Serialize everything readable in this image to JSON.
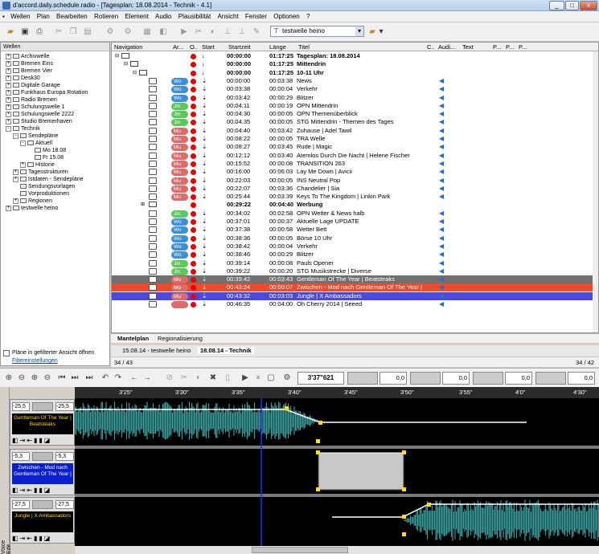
{
  "window": {
    "title": "d'accord.daily.schedule.radio - [Tagesplan: 18.08.2014 - Technik - 4.1]",
    "min": "_",
    "max": "□",
    "close": "x"
  },
  "menu": [
    "Wellen",
    "Plan",
    "Bearbeiten",
    "Rotieren",
    "Element",
    "Audio",
    "Plausibilität",
    "Ansicht",
    "Fenster",
    "Optionen",
    "?"
  ],
  "toolbar": {
    "wellen_combo": "testwelle heino"
  },
  "left": {
    "header": "Wellen",
    "tree": [
      {
        "label": "Archivwelle",
        "level": 0,
        "exp": "+"
      },
      {
        "label": "Bremen Eins",
        "level": 0,
        "exp": "+"
      },
      {
        "label": "Bremen Vier",
        "level": 0,
        "exp": "+"
      },
      {
        "label": "Desk30",
        "level": 0,
        "exp": "+"
      },
      {
        "label": "Digitale Garage",
        "level": 0,
        "exp": "+"
      },
      {
        "label": "Funkhaus Europa Rotation",
        "level": 0,
        "exp": "+"
      },
      {
        "label": "Radio Bremen",
        "level": 0,
        "exp": "+"
      },
      {
        "label": "Schulungswelle 1",
        "level": 0,
        "exp": "+"
      },
      {
        "label": "Schulungswelle 2222",
        "level": 0,
        "exp": "+"
      },
      {
        "label": "Studio Bremerhaven",
        "level": 0,
        "exp": "+"
      },
      {
        "label": "Technik",
        "level": 0,
        "exp": "-"
      },
      {
        "label": "Sendepläne",
        "level": 1,
        "exp": "-"
      },
      {
        "label": "Aktuell",
        "level": 2,
        "exp": "-"
      },
      {
        "label": "Mo 18.08",
        "level": 3,
        "exp": ""
      },
      {
        "label": "Fr 15.08",
        "level": 3,
        "exp": ""
      },
      {
        "label": "Historie",
        "level": 2,
        "exp": "+"
      },
      {
        "label": "Tagesstrukturen",
        "level": 1,
        "exp": "+"
      },
      {
        "label": "Istdaten - Sendepläne",
        "level": 1,
        "exp": "+"
      },
      {
        "label": "Sendungsvorlagen",
        "level": 1,
        "exp": ""
      },
      {
        "label": "Vorproduktionen",
        "level": 1,
        "exp": ""
      },
      {
        "label": "Regionen",
        "level": 1,
        "exp": "+"
      },
      {
        "label": "testwelle heino",
        "level": 0,
        "exp": "+"
      }
    ],
    "checkbox_label": "Pläne in gefilterter Ansicht öffnen",
    "filter_link": "Filtereinstellungen"
  },
  "grid": {
    "headers": [
      "Navigation",
      "Ar...",
      "O..",
      "Start",
      "Startzeit",
      "Länge",
      "Titel",
      "C..",
      "Audi...",
      "Text",
      "P...",
      "P...",
      "P..."
    ],
    "rows": [
      {
        "type": "group",
        "startzeit": "00:00:00",
        "laenge": "01:17:25",
        "titel": "Tagesplan: 18.08.2014",
        "indent": 0
      },
      {
        "type": "group",
        "startzeit": "00:00:00",
        "laenge": "01:17:25",
        "titel": "Mittendrin",
        "indent": 1
      },
      {
        "type": "group",
        "startzeit": "00:00:00",
        "laenge": "01:17:25",
        "titel": "10-11 Uhr",
        "indent": 2
      },
      {
        "pill": "Wo",
        "pc": "#3a8ee0",
        "startzeit": "00:00:00",
        "laenge": "00:03:38",
        "titel": "News"
      },
      {
        "pill": "Wo",
        "pc": "#3a8ee0",
        "startzeit": "00:03:38",
        "laenge": "00:00:04",
        "titel": "Verkehr"
      },
      {
        "pill": "Wo",
        "pc": "#3a8ee0",
        "startzeit": "00:03:42",
        "laenge": "00:00:29",
        "titel": "Blitzer"
      },
      {
        "pill": "Jin",
        "pc": "#5cc85c",
        "startzeit": "00:04:11",
        "laenge": "00:00:19",
        "titel": "OPN Mittendrin"
      },
      {
        "pill": "Jin",
        "pc": "#5cc85c",
        "startzeit": "00:04:30",
        "laenge": "00:00:05",
        "titel": "OPN Themenüberblick"
      },
      {
        "pill": "Jin",
        "pc": "#5cc85c",
        "startzeit": "00:04:35",
        "laenge": "00:00:05",
        "titel": "STG Mittendrin - Themen des Tages"
      },
      {
        "pill": "Mu",
        "pc": "#e06a6a",
        "startzeit": "00:04:40",
        "laenge": "00:03:42",
        "titel": "Zuhause | Adel Tawil"
      },
      {
        "pill": "Mu",
        "pc": "#e06a6a",
        "startzeit": "00:08:22",
        "laenge": "00:00:05",
        "titel": "TRA Welle"
      },
      {
        "pill": "Mu",
        "pc": "#e06a6a",
        "startzeit": "00:08:27",
        "laenge": "00:03:45",
        "titel": "Rude | Magic"
      },
      {
        "pill": "Mu",
        "pc": "#e06a6a",
        "startzeit": "00:12:12",
        "laenge": "00:03:40",
        "titel": "Atemlos Durch Die Nacht | Helene Fischer"
      },
      {
        "pill": "Mu",
        "pc": "#e06a6a",
        "startzeit": "00:15:52",
        "laenge": "00:00:08",
        "titel": "TRANSITION 263"
      },
      {
        "pill": "Mu",
        "pc": "#e06a6a",
        "startzeit": "00:16:00",
        "laenge": "00:06:03",
        "titel": "Lay Me Down | Avicii"
      },
      {
        "pill": "Mu",
        "pc": "#e06a6a",
        "startzeit": "00:22:03",
        "laenge": "00:00:05",
        "titel": "INS Neutral Pop"
      },
      {
        "pill": "Mu",
        "pc": "#e06a6a",
        "startzeit": "00:22:07",
        "laenge": "00:03:36",
        "titel": "Chandelier | Sia"
      },
      {
        "pill": "Mu",
        "pc": "#e06a6a",
        "startzeit": "00:25:44",
        "laenge": "00:03:39",
        "titel": "Keys To The Kingdom | Linkin Park"
      },
      {
        "type": "group2",
        "startzeit": "00:29:22",
        "laenge": "00:04:40",
        "titel": "Werbung"
      },
      {
        "pill": "Jin",
        "pc": "#5cc85c",
        "startzeit": "00:34:02",
        "laenge": "00:02:58",
        "titel": "OPN Wetter & News halb"
      },
      {
        "pill": "Wo",
        "pc": "#3a8ee0",
        "startzeit": "00:37:01",
        "laenge": "00:00:37",
        "titel": "Aktuelle Lage UPDATE"
      },
      {
        "pill": "Wo",
        "pc": "#3a8ee0",
        "startzeit": "00:37:38",
        "laenge": "00:00:58",
        "titel": "Wetter Bett"
      },
      {
        "pill": "Wo",
        "pc": "#3a8ee0",
        "startzeit": "00:38:36",
        "laenge": "00:00:05",
        "titel": "Börse 10 Uhr"
      },
      {
        "pill": "Wo",
        "pc": "#3a8ee0",
        "startzeit": "00:38:42",
        "laenge": "00:00:04",
        "titel": "Verkehr"
      },
      {
        "pill": "Wo",
        "pc": "#3a8ee0",
        "startzeit": "00:38:46",
        "laenge": "00:00:29",
        "titel": "Blitzer"
      },
      {
        "pill": "Jin",
        "pc": "#5cc85c",
        "startzeit": "00:39:14",
        "laenge": "00:00:08",
        "titel": "Pauls Opener"
      },
      {
        "pill": "Jin",
        "pc": "#5cc85c",
        "startzeit": "00:39:22",
        "laenge": "00:00:20",
        "titel": "STG Musikstrecke | Diverse"
      },
      {
        "pill": "Mu",
        "pc": "#e06a6a",
        "startzeit": "00:39:42",
        "laenge": "00:03:43",
        "titel": "Gentleman Of The Year | Beatsteaks",
        "hl": "#707070"
      },
      {
        "pill": "Mo",
        "pc": "#e06a6a",
        "startzeit": "00:43:24",
        "laenge": "00:00:07",
        "titel": "Zwischen - Mod nach Gentleman Of The Year |",
        "hl": "#f04a2a"
      },
      {
        "pill": "Mu",
        "pc": "#e06a6a",
        "startzeit": "00:43:32",
        "laenge": "00:03:03",
        "titel": "Jungle | X Ambassadors",
        "hl": "#4a4ae0"
      },
      {
        "pill": "",
        "pc": "#e06a6a",
        "startzeit": "00:46:35",
        "laenge": "00:04:00",
        "titel": "Oh Cherry 2014 | Seeed"
      }
    ]
  },
  "tabs1": [
    "Mantelplan",
    "Regionalisierung"
  ],
  "tabs2": [
    "15.08.14 - testwelle heino",
    "18.08.14 - Technik"
  ],
  "status": {
    "left": "34 / 43",
    "right": "34 / 42"
  },
  "editor": {
    "time": "3'37\"621",
    "gain_fields": [
      "0,0",
      "0,0",
      "0,0",
      "0,0"
    ],
    "timeline": [
      "3'25\"",
      "3'30\"",
      "3'35\"",
      "3'40\"",
      "3'45\"",
      "3'50\"",
      "3'55\"",
      "4'0\"",
      "4'30\""
    ],
    "voice_label": "Voice Edit",
    "tracks": [
      {
        "name": "Gentleman Of The Year | Beatsteaks",
        "l": "-25,5",
        "r": "-25,5",
        "bg": "#000",
        "fg": "#ffd800"
      },
      {
        "name": "Zwischen - Mod nach Gentleman Of The Year |",
        "l": "-5,3",
        "r": "-5,3",
        "bg": "#0a20d0",
        "fg": "#fff"
      },
      {
        "name": "Jungle | X Ambassadors",
        "l": "-27,5",
        "r": "-27,5",
        "bg": "#000",
        "fg": "#ffd800"
      }
    ]
  }
}
